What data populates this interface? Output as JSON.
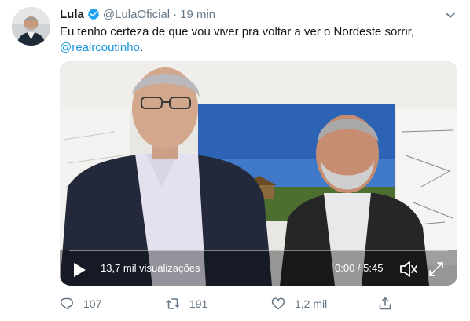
{
  "tweet": {
    "author_name": "Lula",
    "handle": "@LulaOficial",
    "separator": "·",
    "time": "19 min",
    "text": "Eu tenho certeza de que vou viver pra voltar a ver o Nordeste sorrir,",
    "mention": "@realrcoutinho",
    "mention_suffix": "."
  },
  "video": {
    "views": "13,7 mil visualizações",
    "timer": "0:00 / 5:45",
    "progress": 0
  },
  "actions": {
    "replies": "107",
    "retweets": "191",
    "likes": "1,2 mil"
  },
  "icons": {
    "verified": "verified-badge-icon",
    "caret": "chevron-down-icon",
    "play": "play-icon",
    "volume": "volume-icon",
    "fullscreen": "fullscreen-icon",
    "reply": "reply-icon",
    "retweet": "retweet-icon",
    "like": "heart-icon",
    "share": "share-icon"
  },
  "colors": {
    "link": "#1b95e0",
    "muted": "#657786",
    "verified": "#1da1f2"
  }
}
